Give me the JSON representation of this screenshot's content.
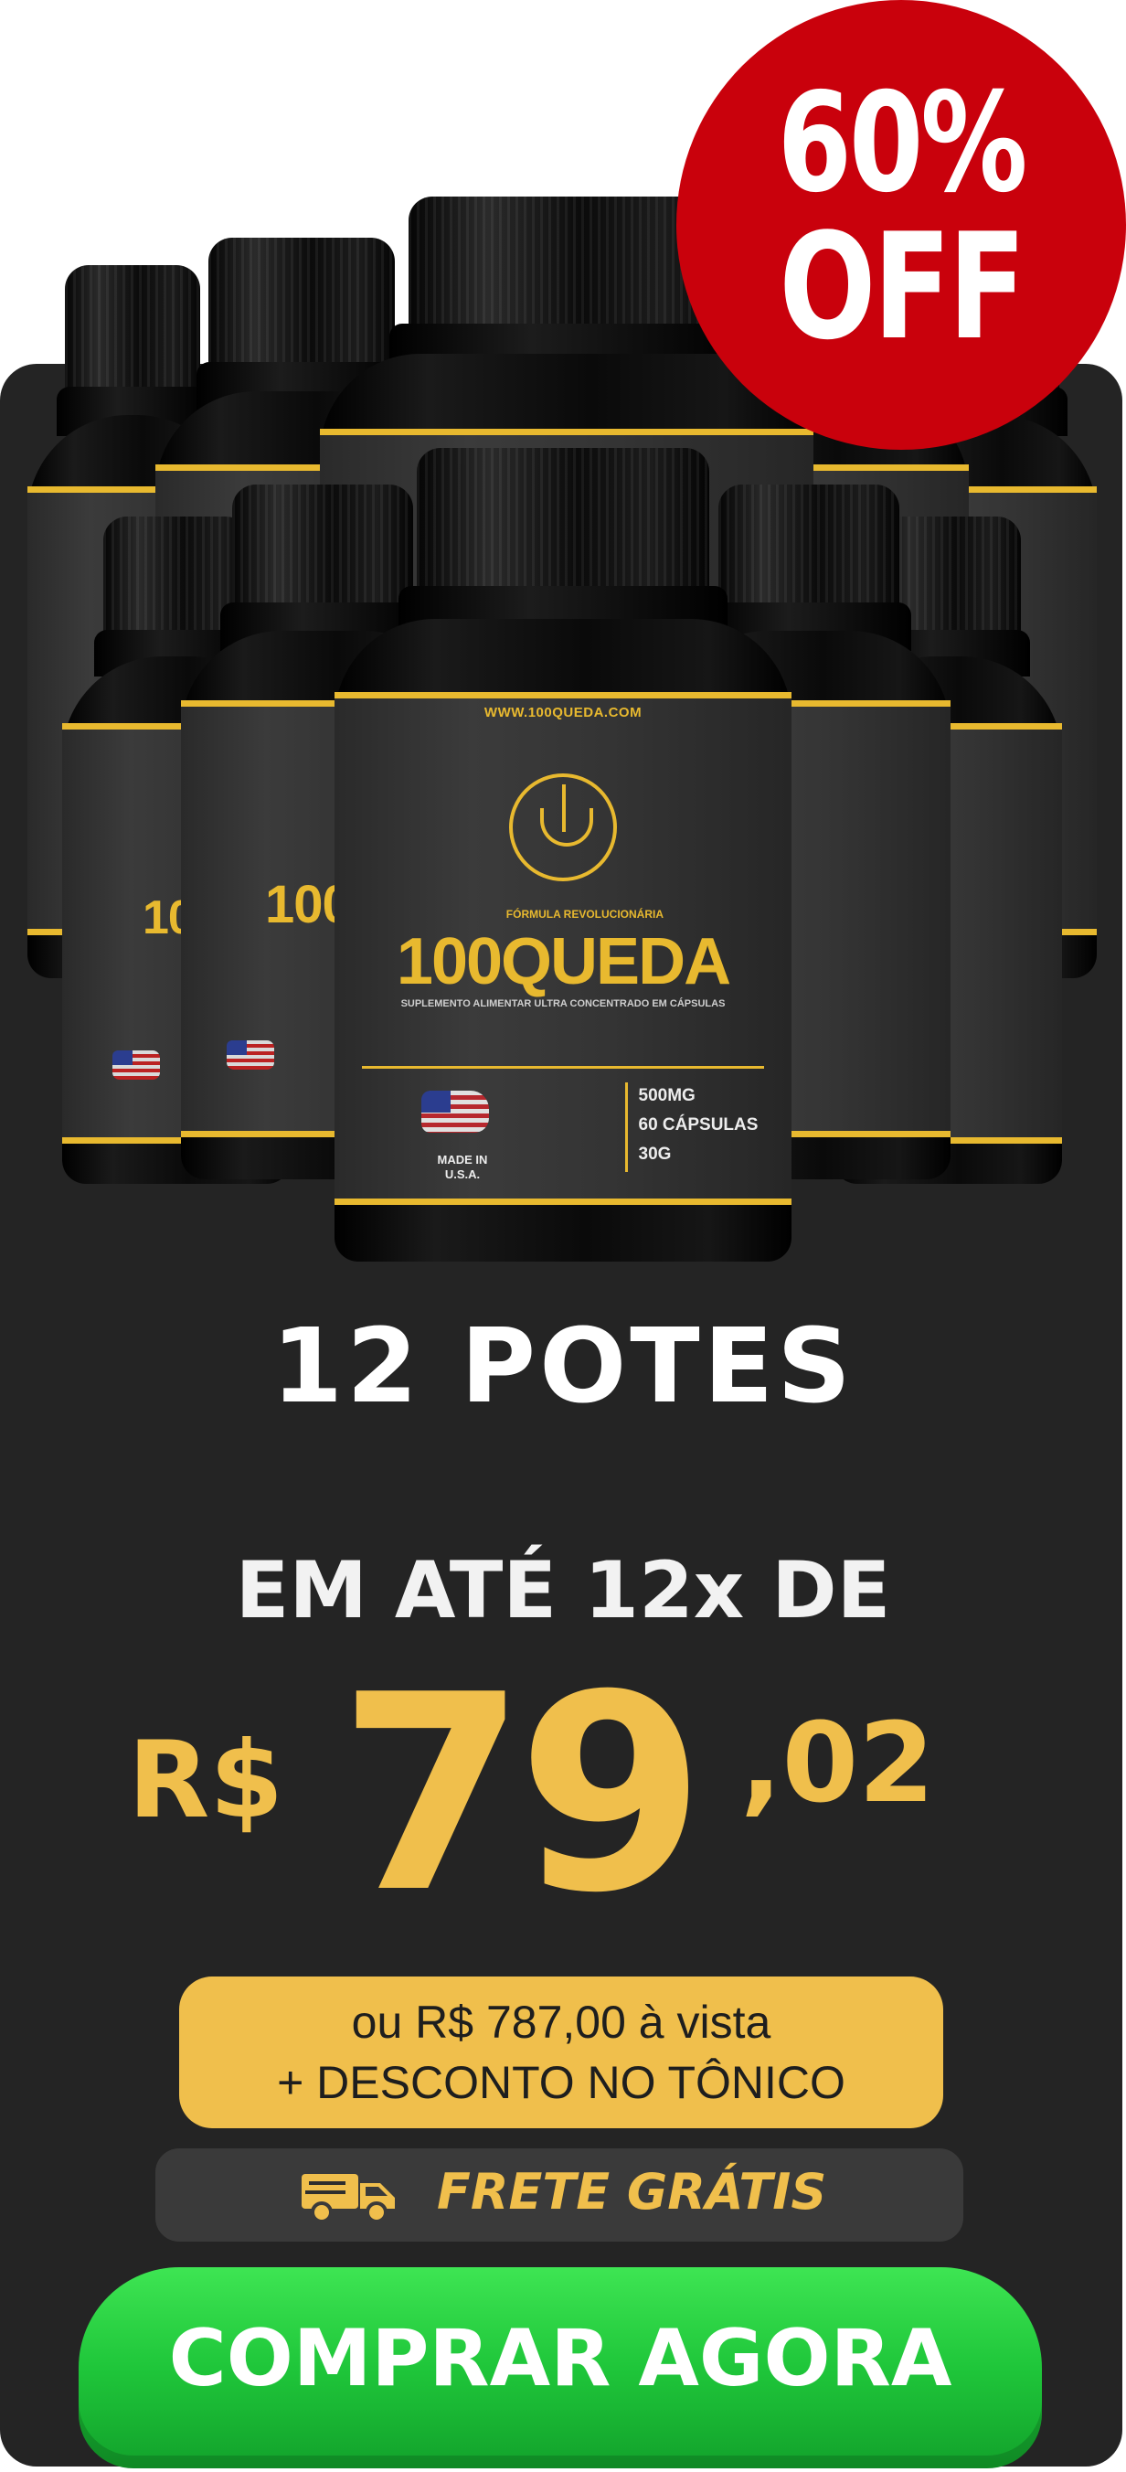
{
  "product": {
    "brand": "100QUEDA",
    "url": "WWW.100QUEDA.COM",
    "formula_tag": "FÓRMULA REVOLUCIONÁRIA",
    "subtitle": "SUPLEMENTO ALIMENTAR ULTRA CONCENTRADO EM CÁPSULAS",
    "made_in": "MADE IN U.S.A.",
    "specs": [
      "500MG",
      "60 CÁPSULAS",
      "30G"
    ]
  },
  "badge": {
    "percent": "60%",
    "off": "OFF"
  },
  "offer": {
    "quantity": "12 POTES",
    "installments_text": "EM ATÉ 12x DE",
    "price_currency": "R$",
    "price_integer": "79",
    "price_cents": ",02",
    "cash_line1": "ou R$ 787,00 à vista",
    "cash_line2": "+ DESCONTO NO TÔNICO",
    "shipping": "FRETE GRÁTIS",
    "shipping_icon": "truck-icon"
  },
  "cta": {
    "label": "COMPRAR AGORA"
  },
  "colors": {
    "card": "#242424",
    "accent": "#f0bf4c",
    "badge": "#c9010c",
    "cta": "#1fc63a"
  }
}
